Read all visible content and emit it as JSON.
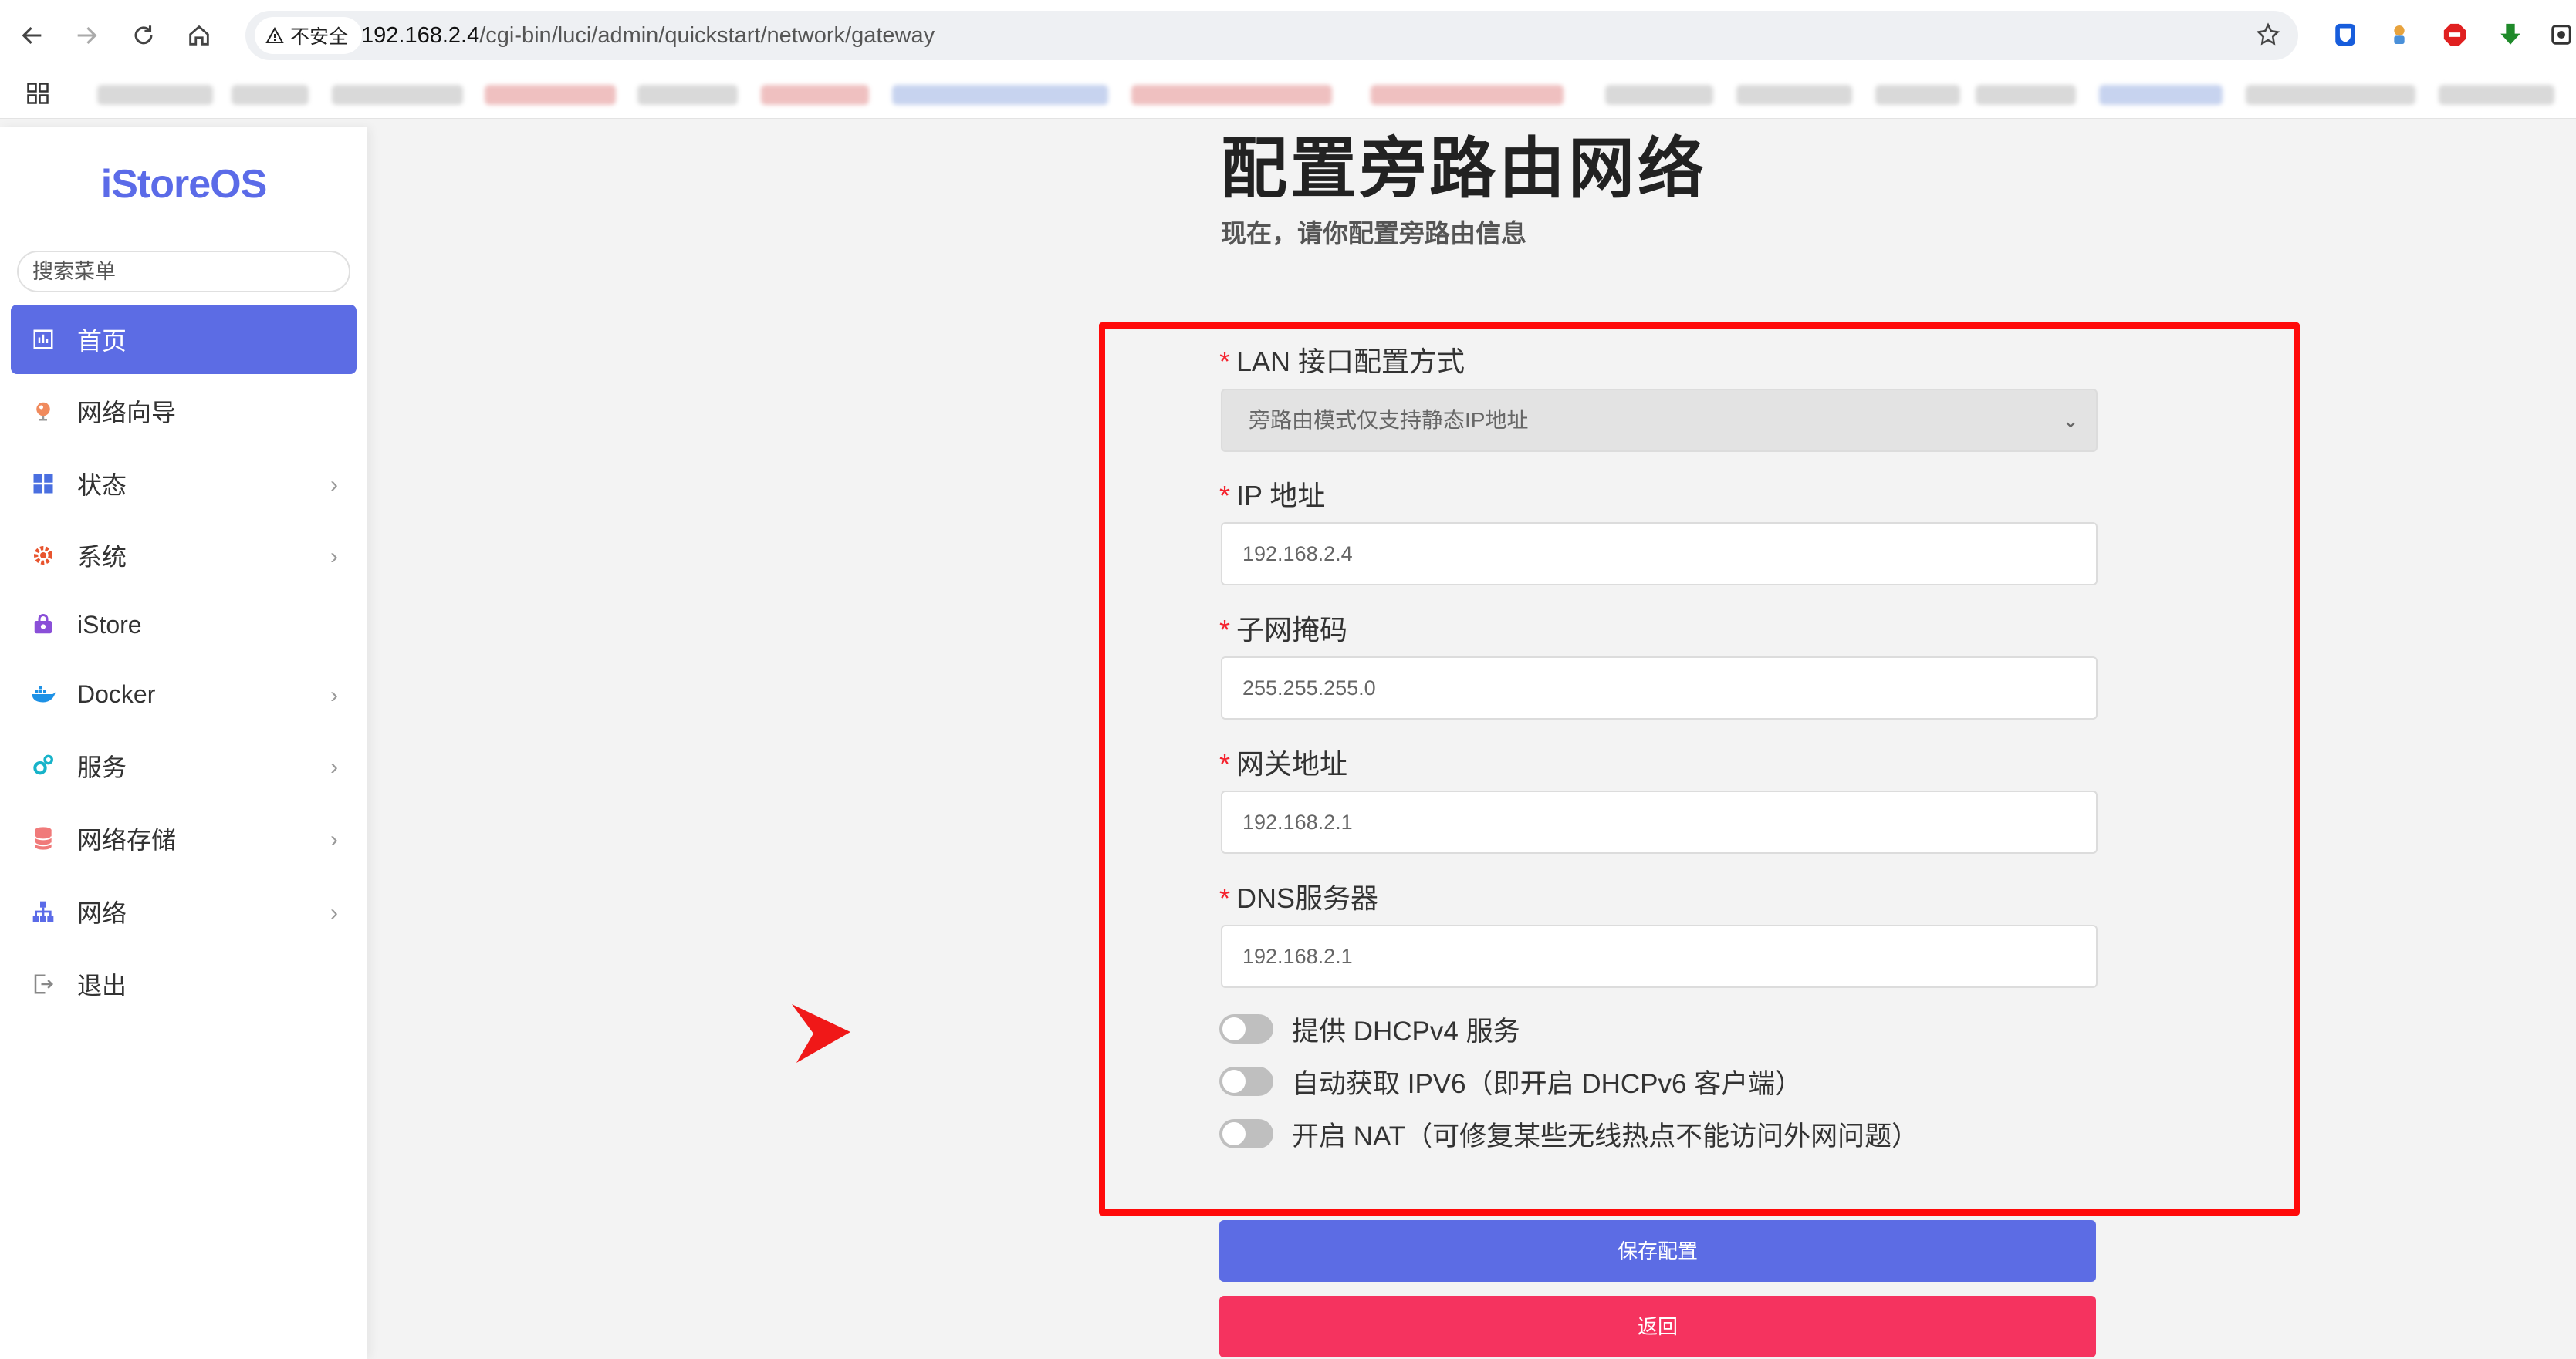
{
  "browser": {
    "security_label": "不安全",
    "url_host": "192.168.2.4",
    "url_path": "/cgi-bin/luci/admin/quickstart/network/gateway"
  },
  "sidebar": {
    "logo": "iStoreOS",
    "search_placeholder": "搜索菜单",
    "items": [
      {
        "label": "首页",
        "icon": "dashboard-icon",
        "has_submenu": false,
        "active": true
      },
      {
        "label": "网络向导",
        "icon": "globe-icon",
        "has_submenu": false
      },
      {
        "label": "状态",
        "icon": "grid-icon",
        "has_submenu": true
      },
      {
        "label": "系统",
        "icon": "gear-icon",
        "has_submenu": true
      },
      {
        "label": "iStore",
        "icon": "store-bag-icon",
        "has_submenu": false
      },
      {
        "label": "Docker",
        "icon": "docker-whale-icon",
        "has_submenu": true
      },
      {
        "label": "服务",
        "icon": "services-gears-icon",
        "has_submenu": true
      },
      {
        "label": "网络存储",
        "icon": "storage-icon",
        "has_submenu": true
      },
      {
        "label": "网络",
        "icon": "network-tree-icon",
        "has_submenu": true
      },
      {
        "label": "退出",
        "icon": "logout-icon",
        "has_submenu": false
      }
    ],
    "chevron": "›"
  },
  "main": {
    "title": "配置旁路由网络",
    "subtitle": "现在，请你配置旁路由信息",
    "form": {
      "lan_mode_label": "LAN 接口配置方式",
      "lan_mode_value": "旁路由模式仅支持静态IP地址",
      "ip_label": "IP 地址",
      "ip_value": "192.168.2.4",
      "netmask_label": "子网掩码",
      "netmask_value": "255.255.255.0",
      "gateway_label": "网关地址",
      "gateway_value": "192.168.2.1",
      "dns_label": "DNS服务器",
      "dns_value": "192.168.2.1",
      "required_mark": "*"
    },
    "toggles": [
      {
        "label": "提供 DHCPv4 服务",
        "on": false
      },
      {
        "label": "自动获取 IPV6（即开启 DHCPv6 客户端）",
        "on": false
      },
      {
        "label": "开启 NAT（可修复某些无线热点不能访问外网问题）",
        "on": false
      }
    ],
    "save_button": "保存配置",
    "back_button": "返回"
  },
  "colors": {
    "accent": "#5c6ce4",
    "danger": "#f5335f",
    "highlight_border": "#ff0a0a",
    "required": "#f5222d"
  }
}
